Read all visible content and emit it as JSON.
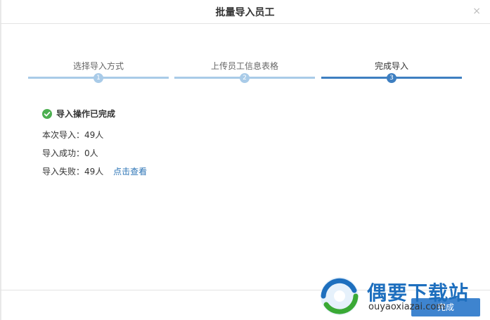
{
  "dialog": {
    "title": "批量导入员工",
    "close_symbol": "×"
  },
  "steps": [
    {
      "label": "选择导入方式",
      "number": "1",
      "state": "completed"
    },
    {
      "label": "上传员工信息表格",
      "number": "2",
      "state": "completed"
    },
    {
      "label": "完成导入",
      "number": "3",
      "state": "active"
    }
  ],
  "result": {
    "status": "导入操作已完成",
    "total_label": "本次导入：49人",
    "success_label": "导入成功：0人",
    "failed_label": "导入失败：49人",
    "view_link": "点击查看"
  },
  "footer": {
    "done_label": "完成"
  },
  "watermark": {
    "title": "偶要下载站",
    "url": "ouyaoxiazai.com"
  },
  "colors": {
    "accent": "#3e7fc1",
    "step_inactive": "#a9cbe8",
    "success": "#4caf50",
    "link": "#2e75b6"
  },
  "icons": {
    "status": "check-circle-icon",
    "close": "close-icon"
  }
}
